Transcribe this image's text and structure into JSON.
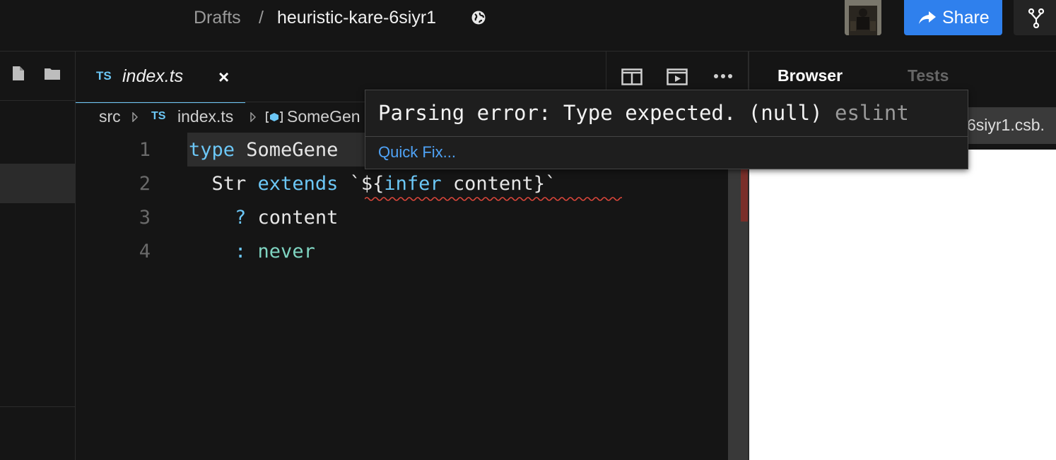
{
  "header": {
    "breadcrumb_root": "Drafts",
    "breadcrumb_sep": "/",
    "sandbox_name": "heuristic-kare-6siyr1",
    "share_label": "Share",
    "accent": "#2f80ed"
  },
  "tabs": [
    {
      "badge": "TS",
      "label": "index.ts",
      "close": "×"
    }
  ],
  "breadcrumbs": {
    "folder": "src",
    "file_badge": "TS",
    "file": "index.ts",
    "symbol": "SomeGen"
  },
  "editor": {
    "lines": [
      {
        "num": "1",
        "tokens": [
          "type",
          " SomeGene"
        ]
      },
      {
        "num": "2",
        "tokens": [
          "  Str ",
          "extends",
          " `${",
          "infer",
          " content}`"
        ]
      },
      {
        "num": "3",
        "tokens": [
          "    ? ",
          "content"
        ]
      },
      {
        "num": "4",
        "tokens": [
          "    : ",
          "never"
        ]
      }
    ]
  },
  "hover": {
    "message": "Parsing error: Type expected. (null)",
    "source": "eslint",
    "quick_fix": "Quick Fix..."
  },
  "preview": {
    "tab_browser": "Browser",
    "tab_tests": "Tests",
    "url_fragment": "6siyr1.csb."
  },
  "icons": {
    "globe": "globe-icon",
    "share": "share-arrow-icon",
    "fork": "fork-icon",
    "new_file": "new-file-icon",
    "new_folder": "new-folder-icon",
    "split": "split-editor-icon",
    "preview": "open-preview-icon",
    "more": "more-icon"
  }
}
